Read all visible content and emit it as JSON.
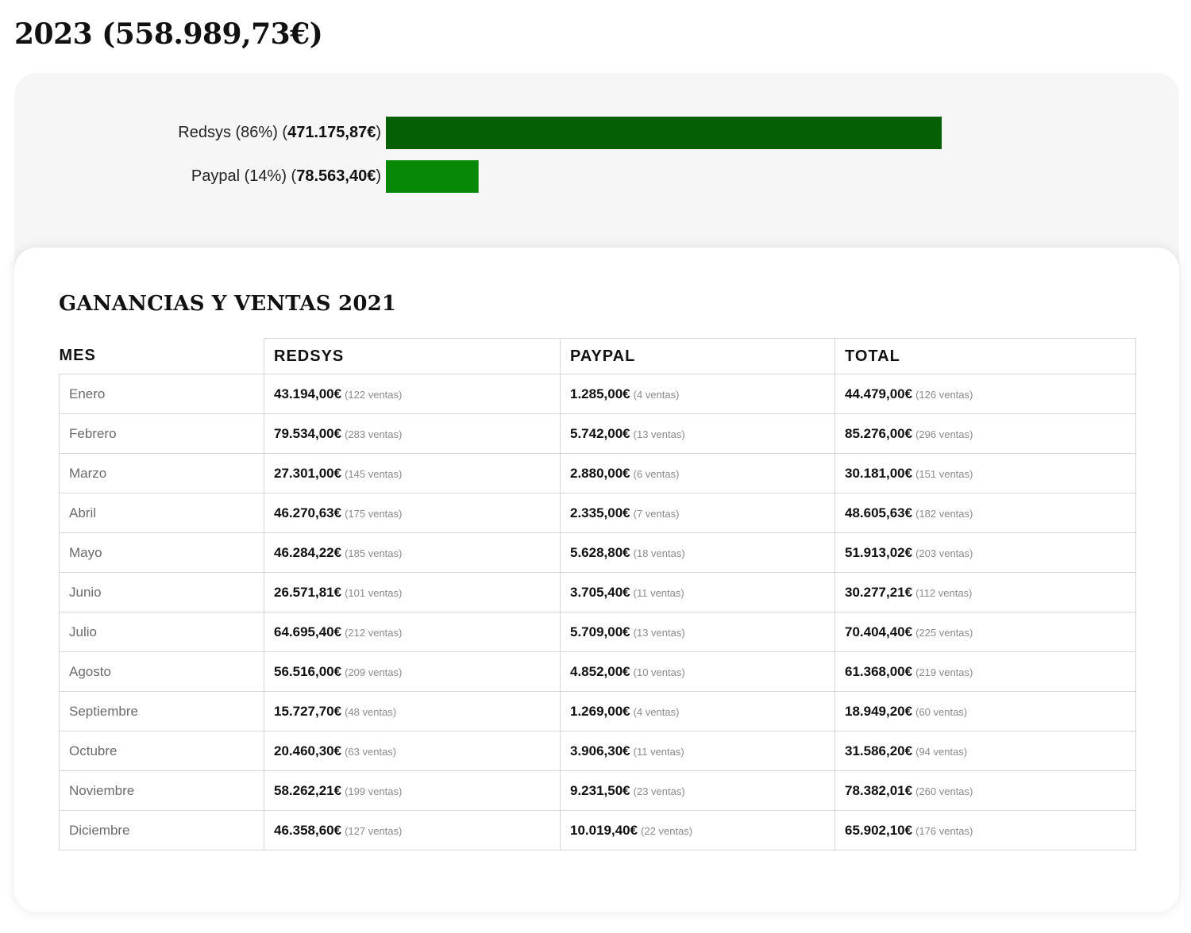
{
  "page": {
    "title": "2023 (558.989,73€)"
  },
  "chart_data": {
    "type": "bar",
    "orientation": "horizontal",
    "categories": [
      "Redsys",
      "Paypal"
    ],
    "percentages": [
      "86%",
      "14%"
    ],
    "amounts": [
      "471.175,87€",
      "78.563,40€"
    ],
    "values": [
      471175.87,
      78563.4
    ],
    "colors": [
      "#056005",
      "#078807"
    ],
    "title": "",
    "xlabel": "",
    "ylabel": "",
    "grid": false
  },
  "table": {
    "title": "GANANCIAS Y VENTAS 2021",
    "headers": [
      "MES",
      "REDSYS",
      "PAYPAL",
      "TOTAL"
    ],
    "rows": [
      {
        "month": "Enero",
        "redsys": "43.194,00€",
        "redsys_sales": "(122 ventas)",
        "paypal": "1.285,00€",
        "paypal_sales": "(4 ventas)",
        "total": "44.479,00€",
        "total_sales": "(126 ventas)"
      },
      {
        "month": "Febrero",
        "redsys": "79.534,00€",
        "redsys_sales": "(283 ventas)",
        "paypal": "5.742,00€",
        "paypal_sales": "(13 ventas)",
        "total": "85.276,00€",
        "total_sales": "(296 ventas)"
      },
      {
        "month": "Marzo",
        "redsys": "27.301,00€",
        "redsys_sales": "(145 ventas)",
        "paypal": "2.880,00€",
        "paypal_sales": "(6 ventas)",
        "total": "30.181,00€",
        "total_sales": "(151 ventas)"
      },
      {
        "month": "Abril",
        "redsys": "46.270,63€",
        "redsys_sales": "(175 ventas)",
        "paypal": "2.335,00€",
        "paypal_sales": "(7 ventas)",
        "total": "48.605,63€",
        "total_sales": "(182 ventas)"
      },
      {
        "month": "Mayo",
        "redsys": "46.284,22€",
        "redsys_sales": "(185 ventas)",
        "paypal": "5.628,80€",
        "paypal_sales": "(18 ventas)",
        "total": "51.913,02€",
        "total_sales": "(203 ventas)"
      },
      {
        "month": "Junio",
        "redsys": "26.571,81€",
        "redsys_sales": "(101 ventas)",
        "paypal": "3.705,40€",
        "paypal_sales": "(11 ventas)",
        "total": "30.277,21€",
        "total_sales": "(112 ventas)"
      },
      {
        "month": "Julio",
        "redsys": "64.695,40€",
        "redsys_sales": "(212 ventas)",
        "paypal": "5.709,00€",
        "paypal_sales": "(13 ventas)",
        "total": "70.404,40€",
        "total_sales": "(225 ventas)"
      },
      {
        "month": "Agosto",
        "redsys": "56.516,00€",
        "redsys_sales": "(209 ventas)",
        "paypal": "4.852,00€",
        "paypal_sales": "(10 ventas)",
        "total": "61.368,00€",
        "total_sales": "(219 ventas)"
      },
      {
        "month": "Septiembre",
        "redsys": "15.727,70€",
        "redsys_sales": "(48 ventas)",
        "paypal": "1.269,00€",
        "paypal_sales": "(4 ventas)",
        "total": "18.949,20€",
        "total_sales": "(60 ventas)"
      },
      {
        "month": "Octubre",
        "redsys": "20.460,30€",
        "redsys_sales": "(63 ventas)",
        "paypal": "3.906,30€",
        "paypal_sales": "(11 ventas)",
        "total": "31.586,20€",
        "total_sales": "(94 ventas)"
      },
      {
        "month": "Noviembre",
        "redsys": "58.262,21€",
        "redsys_sales": "(199 ventas)",
        "paypal": "9.231,50€",
        "paypal_sales": "(23 ventas)",
        "total": "78.382,01€",
        "total_sales": "(260 ventas)"
      },
      {
        "month": "Diciembre",
        "redsys": "46.358,60€",
        "redsys_sales": "(127 ventas)",
        "paypal": "10.019,40€",
        "paypal_sales": "(22 ventas)",
        "total": "65.902,10€",
        "total_sales": "(176 ventas)"
      }
    ]
  }
}
